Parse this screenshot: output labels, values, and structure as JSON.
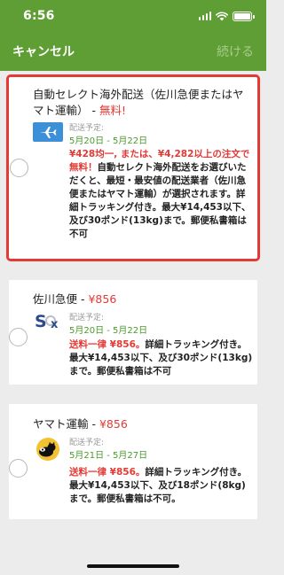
{
  "status_bar": {
    "time": "6:56"
  },
  "nav": {
    "cancel_label": "キャンセル",
    "continue_label": "続ける"
  },
  "options": [
    {
      "title": "自動セレクト海外配送（佐川急便またはヤマト運輸） - ",
      "price": "無料!",
      "icon": "airplane-icon",
      "eta_label": "配送予定:",
      "eta_dates": "5月20日 - 5月22日",
      "desc_red": "¥428均一, または、¥4,282以上の注文で無料！",
      "desc": "自動セレクト海外配送をお選びいただくと、最短・最安値の配送業者（佐川急便またはヤマト運輸）が選択されます。詳細トラッキング付き。最大¥14,453以下、及び30ポンド(13kg)まで。郵便私書箱は不可"
    },
    {
      "title": "佐川急便 - ",
      "price": "¥856",
      "icon": "sagawa-logo-icon",
      "eta_label": "配送予定:",
      "eta_dates": "5月20日 - 5月22日",
      "desc_red": "送料一律 ¥856。",
      "desc": "詳細トラッキング付き。最大¥14,453以下、及び30ポンド(13kg)まで。郵便私書箱は不可"
    },
    {
      "title": "ヤマト運輸 - ",
      "price": "¥856",
      "icon": "yamato-cat-logo-icon",
      "eta_label": "配送予定:",
      "eta_dates": "5月21日 - 5月27日",
      "desc_red": "送料一律 ¥856。",
      "desc": "詳細トラッキング付き。最大¥14,453以下、及び18ポンド(8kg)まで。郵便私書箱は不可。"
    }
  ],
  "colors": {
    "header_green": "#5e9e34",
    "accent_red": "#e53935",
    "eta_green": "#4a9a2a"
  }
}
